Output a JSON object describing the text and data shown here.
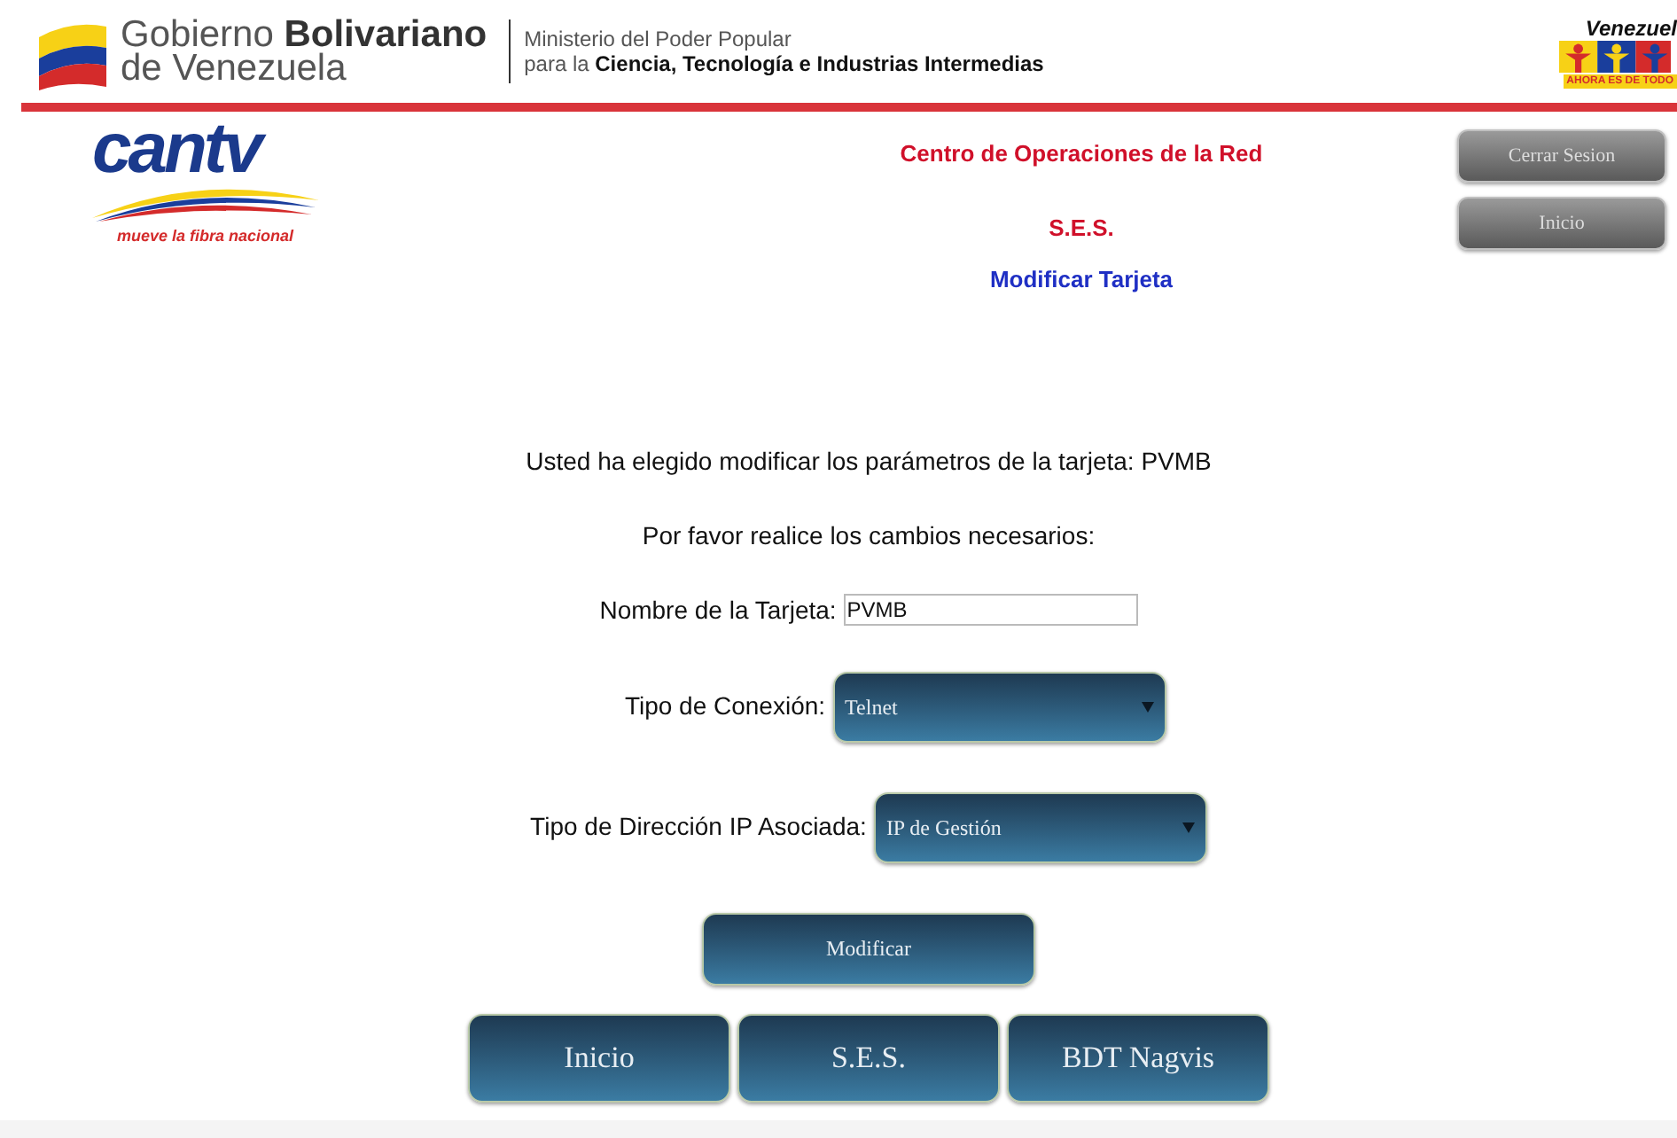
{
  "header": {
    "government": {
      "line_1_regular": "Gobierno",
      "line_1_bold": "Bolivariano",
      "line_2": "de Venezuela"
    },
    "ministry": {
      "line_1": "Ministerio del Poder Popular",
      "line_2": "para la **Ciencia, Tecnología e Industrias Intermedias**"
    },
    "campaign_logo": {
      "title": "Venezuel",
      "slogan": "AHORA ES DE TODO"
    }
  },
  "brand": {
    "name": "cantv",
    "tagline": "mueve la fibra nacional"
  },
  "titles": {
    "center": "Centro de Operaciones de la Red",
    "system": "S.E.S.",
    "page": "Modificar Tarjeta"
  },
  "top_buttons": [
    "Cerrar Sesion",
    "Inicio"
  ],
  "messages": [
    "Usted ha elegido modificar los parámetros de la tarjeta: PVMB",
    "Por favor realice los cambios necesarios:"
  ],
  "fields": [
    {
      "kind": "text",
      "label": "Nombre de la Tarjeta:",
      "value": "PVMB"
    },
    {
      "kind": "select",
      "label": "Tipo de Conexión:",
      "value": "Telnet"
    },
    {
      "kind": "select",
      "label": "Tipo de Dirección IP Asociada:",
      "value": "IP de Gestión"
    }
  ],
  "submit": "Modificar",
  "nav_buttons": [
    "Inicio",
    "S.E.S.",
    "BDT Nagvis"
  ]
}
